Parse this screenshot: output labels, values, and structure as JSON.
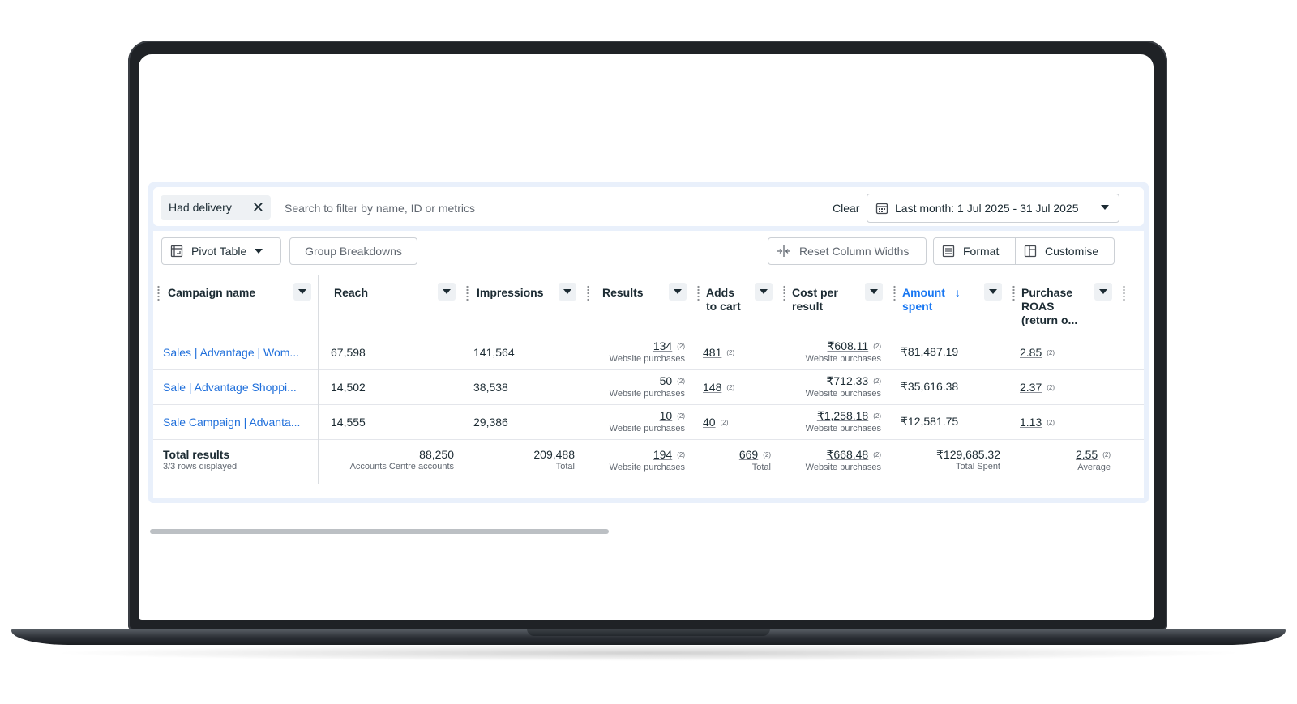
{
  "filter": {
    "chip_label": "Had delivery",
    "search_placeholder": "Search to filter by name, ID or metrics",
    "clear_label": "Clear",
    "date_range": "Last month: 1 Jul 2025 - 31 Jul 2025"
  },
  "toolbar": {
    "pivot_label": "Pivot Table",
    "group_label": "Group Breakdowns",
    "reset_label": "Reset Column Widths",
    "format_label": "Format",
    "customise_label": "Customise"
  },
  "columns": {
    "campaign": "Campaign name",
    "reach": "Reach",
    "impressions": "Impressions",
    "results": "Results",
    "adds_1": "Adds",
    "adds_2": "to cart",
    "cost_1": "Cost per",
    "cost_2": "result",
    "amount_1": "Amount",
    "amount_2": "spent",
    "roas_1": "Purchase",
    "roas_2": "ROAS",
    "roas_3": "(return o..."
  },
  "rows": [
    {
      "name": "Sales | Advantage | Wom...",
      "reach": "67,598",
      "impressions": "141,564",
      "results": "134",
      "results_sub": "Website purchases",
      "adds": "481",
      "cost": "₹608.11",
      "cost_sub": "Website purchases",
      "amount": "₹81,487.19",
      "roas": "2.85"
    },
    {
      "name": "Sale | Advantage Shoppi...",
      "reach": "14,502",
      "impressions": "38,538",
      "results": "50",
      "results_sub": "Website purchases",
      "adds": "148",
      "cost": "₹712.33",
      "cost_sub": "Website purchases",
      "amount": "₹35,616.38",
      "roas": "2.37"
    },
    {
      "name": "Sale Campaign | Advanta...",
      "reach": "14,555",
      "impressions": "29,386",
      "results": "10",
      "results_sub": "Website purchases",
      "adds": "40",
      "cost": "₹1,258.18",
      "cost_sub": "Website purchases",
      "amount": "₹12,581.75",
      "roas": "1.13"
    }
  ],
  "totals": {
    "title": "Total results",
    "rows_displayed": "3/3 rows displayed",
    "reach": "88,250",
    "reach_sub": "Accounts Centre accounts",
    "impressions": "209,488",
    "impressions_sub": "Total",
    "results": "194",
    "results_sub": "Website purchases",
    "adds": "669",
    "adds_sub": "Total",
    "cost": "₹668.48",
    "cost_sub": "Website purchases",
    "amount": "₹129,685.32",
    "amount_sub": "Total Spent",
    "roas": "2.55",
    "roas_sub": "Average"
  },
  "badge": "(2)",
  "colors": {
    "link": "#1f6fdb",
    "accent": "#1877f2",
    "panel_bg": "#e9f0fb"
  }
}
